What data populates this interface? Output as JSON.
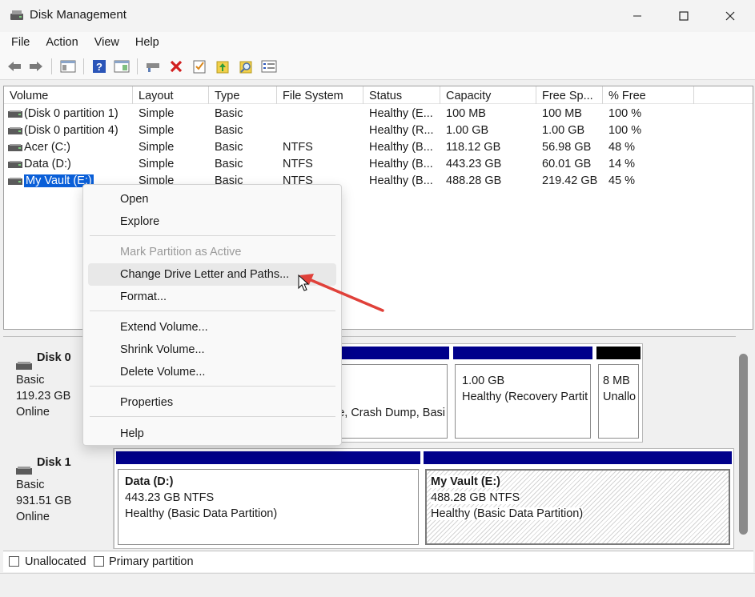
{
  "window": {
    "title": "Disk Management"
  },
  "menu": [
    "File",
    "Action",
    "View",
    "Help"
  ],
  "toolbar": {
    "icons": [
      "back-icon",
      "forward-icon",
      "disk-list-icon",
      "help-icon",
      "help-topics-icon",
      "connect-icon",
      "delete-icon",
      "check-icon",
      "export-icon",
      "search-icon",
      "properties-icon"
    ]
  },
  "columns": [
    "Volume",
    "Layout",
    "Type",
    "File System",
    "Status",
    "Capacity",
    "Free Sp...",
    "% Free"
  ],
  "volumes": [
    {
      "name": "(Disk 0 partition 1)",
      "layout": "Simple",
      "type": "Basic",
      "fs": "",
      "status": "Healthy (E...",
      "capacity": "100 MB",
      "free": "100 MB",
      "pct": "100 %"
    },
    {
      "name": "(Disk 0 partition 4)",
      "layout": "Simple",
      "type": "Basic",
      "fs": "",
      "status": "Healthy (R...",
      "capacity": "1.00 GB",
      "free": "1.00 GB",
      "pct": "100 %"
    },
    {
      "name": "Acer (C:)",
      "layout": "Simple",
      "type": "Basic",
      "fs": "NTFS",
      "status": "Healthy (B...",
      "capacity": "118.12 GB",
      "free": "56.98 GB",
      "pct": "48 %"
    },
    {
      "name": "Data (D:)",
      "layout": "Simple",
      "type": "Basic",
      "fs": "NTFS",
      "status": "Healthy (B...",
      "capacity": "443.23 GB",
      "free": "60.01 GB",
      "pct": "14 %"
    },
    {
      "name": "My Vault (E:)",
      "layout": "Simple",
      "type": "Basic",
      "fs": "NTFS",
      "status": "Healthy (B...",
      "capacity": "488.28 GB",
      "free": "219.42 GB",
      "pct": "45 %"
    }
  ],
  "context_menu": {
    "items": [
      "Open",
      "Explore",
      "Mark Partition as Active",
      "Change Drive Letter and Paths...",
      "Format...",
      "Extend Volume...",
      "Shrink Volume...",
      "Delete Volume...",
      "Properties",
      "Help"
    ],
    "disabled_item": "Mark Partition as Active",
    "hovered_item": "Change Drive Letter and Paths..."
  },
  "disks": [
    {
      "name": "Disk 0",
      "type": "Basic",
      "size": "119.23 GB",
      "status": "Online",
      "partitions": [
        {
          "lines": [
            "",
            "e, Crash Dump, Basi"
          ]
        },
        {
          "lines": [
            "1.00 GB",
            "Healthy (Recovery Partit"
          ]
        },
        {
          "lines": [
            "8 MB",
            "Unallo"
          ]
        }
      ]
    },
    {
      "name": "Disk 1",
      "type": "Basic",
      "size": "931.51 GB",
      "status": "Online",
      "partitions": [
        {
          "title": "Data  (D:)",
          "lines": [
            "443.23 GB NTFS",
            "Healthy (Basic Data Partition)"
          ]
        },
        {
          "title": "My Vault  (E:)",
          "lines": [
            "488.28 GB NTFS",
            "Healthy (Basic Data Partition)"
          ]
        }
      ]
    }
  ],
  "legend": [
    {
      "label": "Unallocated",
      "color": "#000000"
    },
    {
      "label": "Primary partition",
      "color": "#00008b"
    }
  ],
  "colors": {
    "primary_partition": "#00008b",
    "unallocated": "#000000",
    "selection": "#0a5fd8",
    "annotation_arrow": "#e0413a"
  }
}
